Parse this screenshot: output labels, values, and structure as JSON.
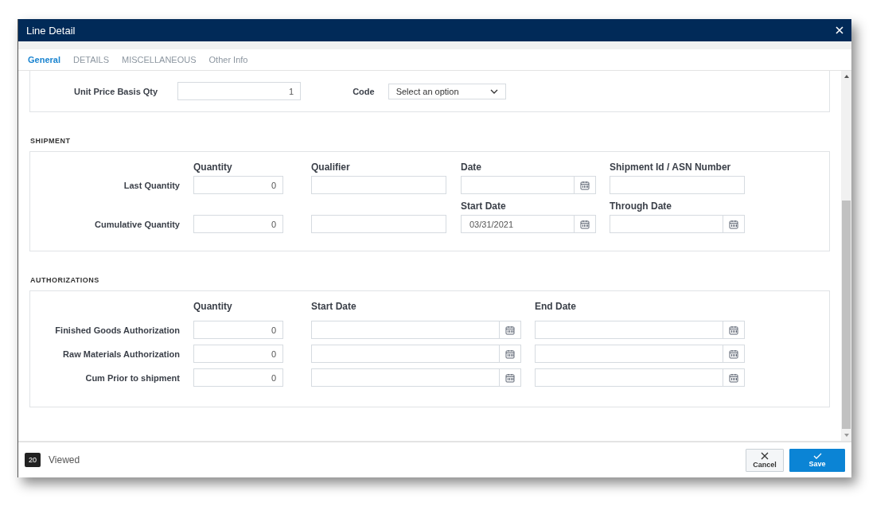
{
  "dialog": {
    "title": "Line Detail"
  },
  "tabs": [
    {
      "label": "General",
      "selected": true
    },
    {
      "label": "DETAILS",
      "selected": false
    },
    {
      "label": "MISCELLANEOUS",
      "selected": false
    },
    {
      "label": "Other Info",
      "selected": false
    }
  ],
  "pricing": {
    "fields": [
      {
        "kind": "number",
        "label": "Unit Price Basis Qty",
        "value": "1"
      },
      {
        "kind": "select",
        "label": "Code",
        "placeholder": "Select an option"
      }
    ]
  },
  "shipment": {
    "heading": "SHIPMENT",
    "rows": [
      {
        "label": "Last Quantity",
        "fields": [
          {
            "kind": "number",
            "heading": "Quantity",
            "value": "0"
          },
          {
            "kind": "text",
            "heading": "Qualifier"
          },
          {
            "kind": "date",
            "heading": "Date"
          },
          {
            "kind": "text",
            "heading": "Shipment Id / ASN Number"
          }
        ]
      },
      {
        "label": "Cumulative Quantity",
        "fields": [
          {
            "kind": "number",
            "value": "0"
          },
          {
            "kind": "text"
          },
          {
            "kind": "date",
            "heading": "Start Date",
            "value": "03/31/2021"
          },
          {
            "kind": "date",
            "heading": "Through Date"
          }
        ]
      }
    ]
  },
  "authorizations": {
    "heading": "AUTHORIZATIONS",
    "columns": [
      "Quantity",
      "Start Date",
      "End Date"
    ],
    "rows": [
      {
        "label": "Finished Goods Authorization",
        "quantity": "0"
      },
      {
        "label": "Raw Materials Authorization",
        "quantity": "0"
      },
      {
        "label": "Cum Prior to shipment",
        "quantity": "0"
      }
    ]
  },
  "footer": {
    "count": "20",
    "status": "Viewed",
    "buttons": [
      {
        "kind": "cancel",
        "label": "Cancel"
      },
      {
        "kind": "save",
        "label": "Save"
      }
    ]
  }
}
